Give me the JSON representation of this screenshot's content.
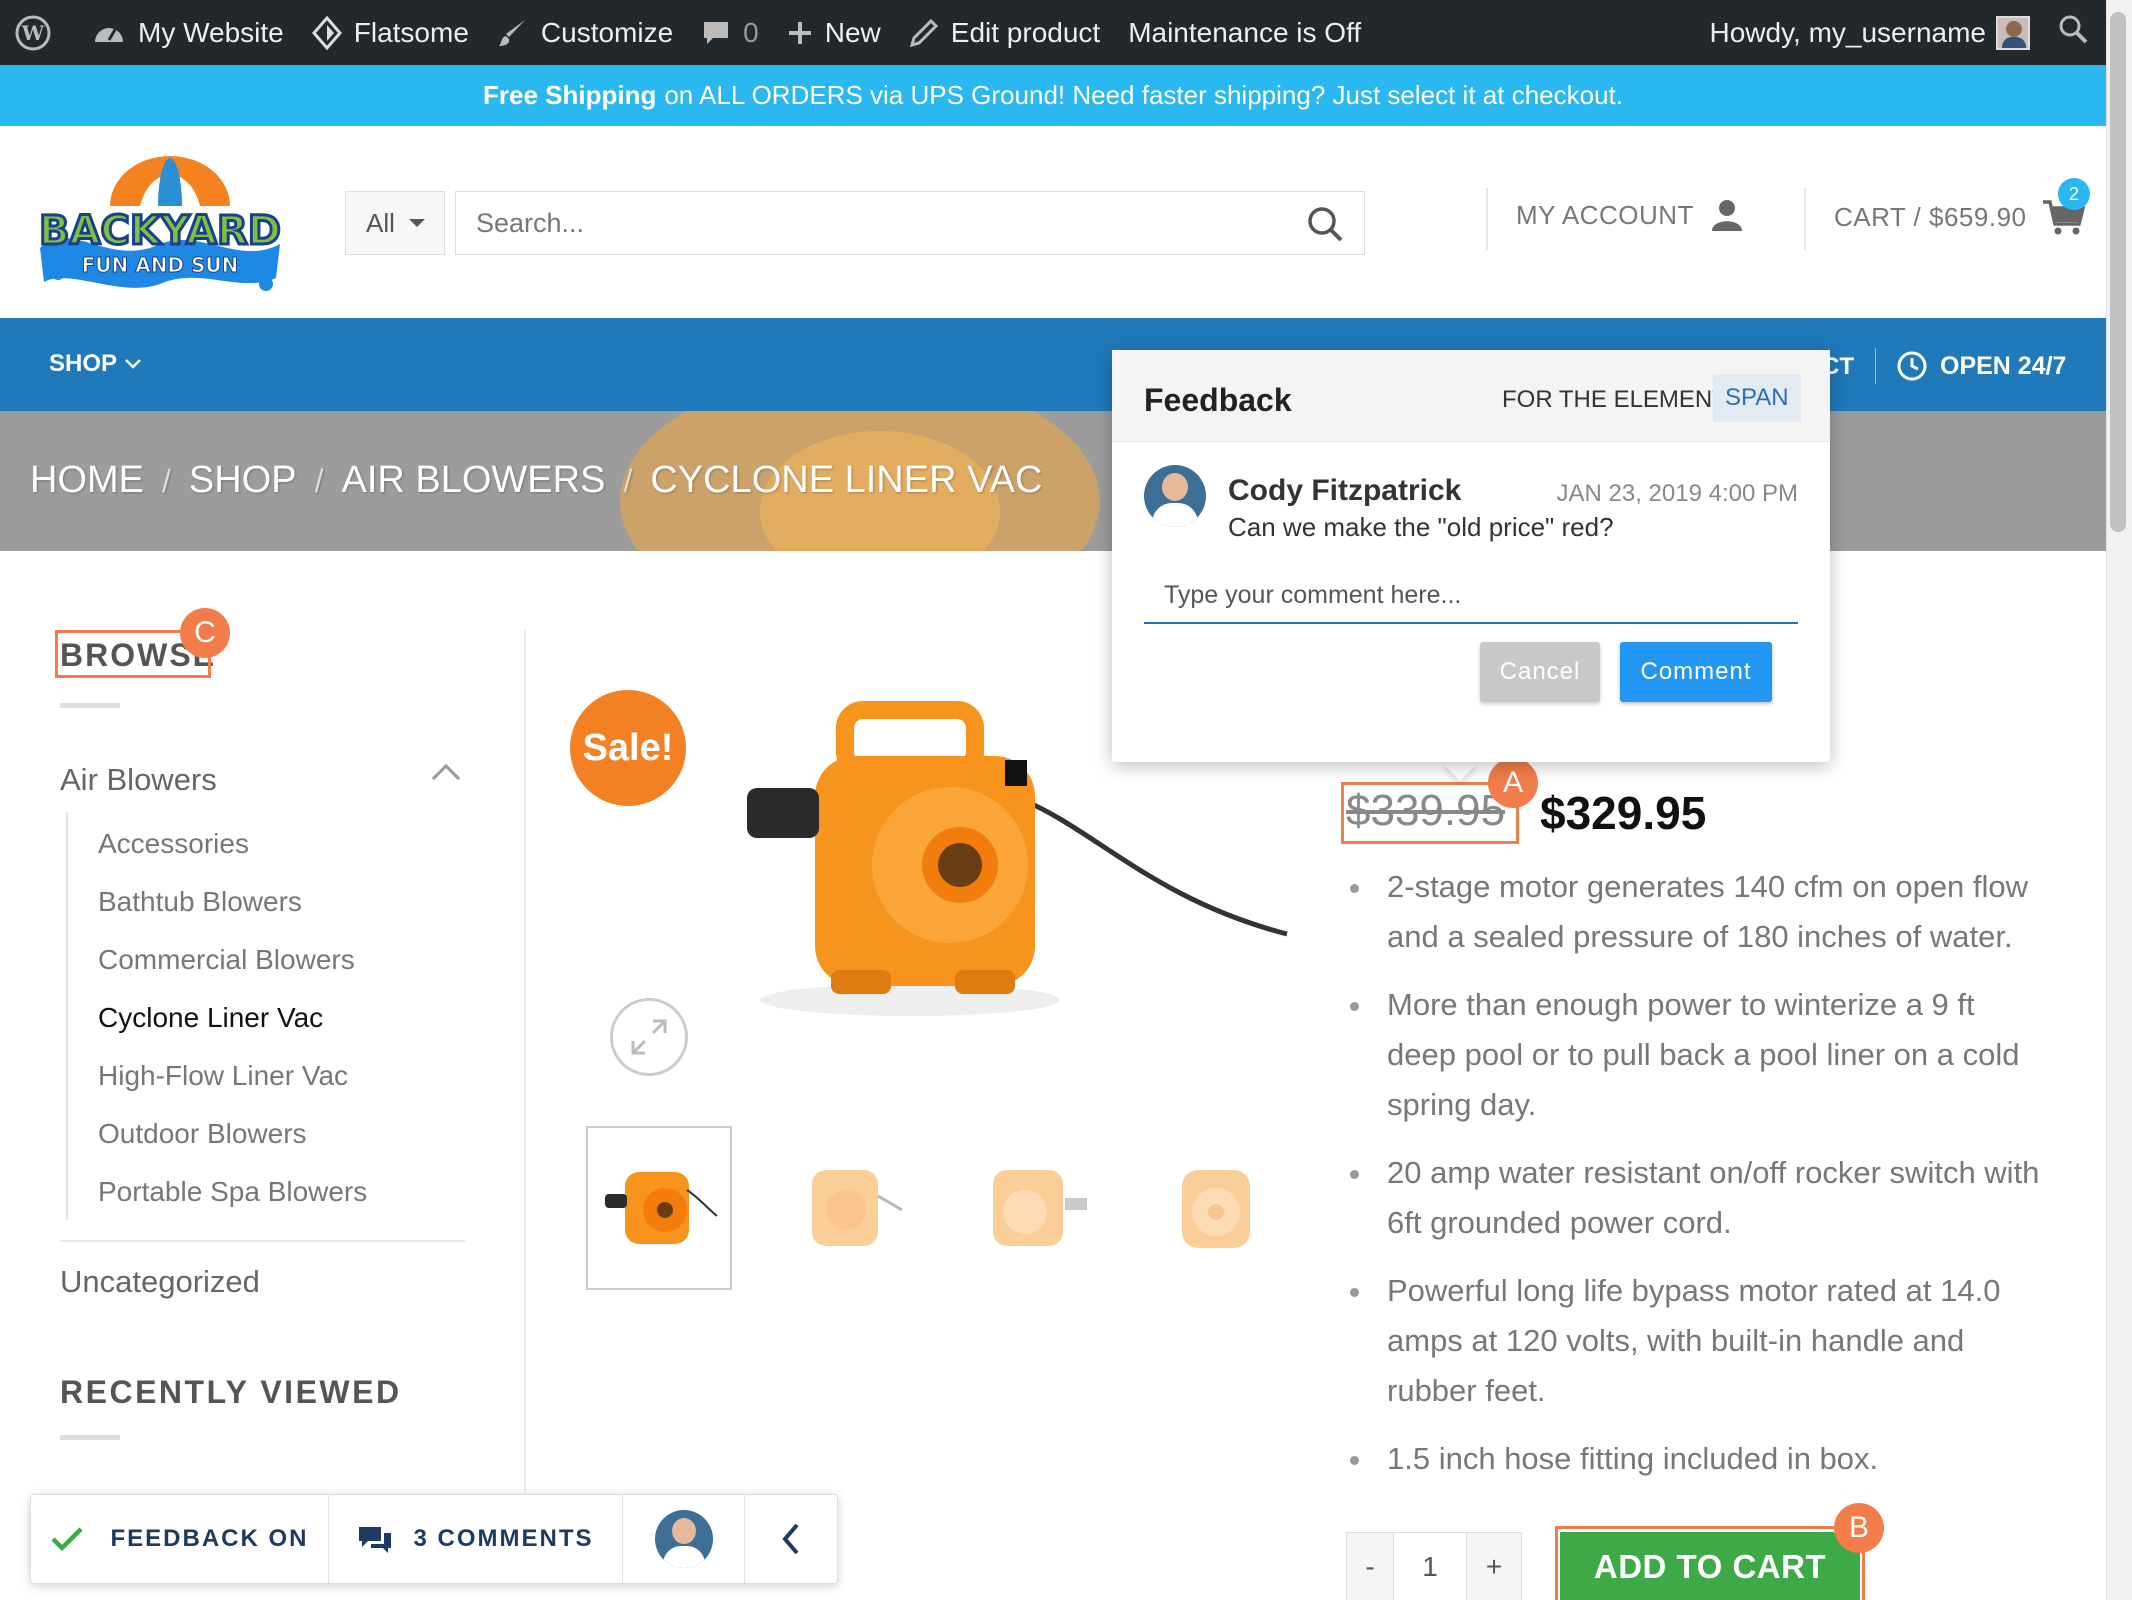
{
  "admin_bar": {
    "site_name": "My Website",
    "theme": "Flatsome",
    "customize": "Customize",
    "comments_count": "0",
    "new": "New",
    "edit_product": "Edit product",
    "maintenance": "Maintenance is Off",
    "howdy": "Howdy, my_username"
  },
  "banner": {
    "bold": "Free Shipping",
    "text": "on ALL ORDERS via UPS Ground! Need faster shipping? Just select it at checkout."
  },
  "header": {
    "logo_line1": "BACKYARD",
    "logo_line2": "FUN AND SUN",
    "search_category": "All",
    "search_placeholder": "Search...",
    "my_account": "MY ACCOUNT",
    "cart": "CART / $659.90",
    "cart_count": "2"
  },
  "nav": {
    "shop": "SHOP",
    "partial_item": "CT",
    "open": "OPEN 24/7"
  },
  "breadcrumb": [
    "HOME",
    "SHOP",
    "AIR BLOWERS",
    "CYCLONE LINER VAC"
  ],
  "sidebar": {
    "browse_title": "BROWSE",
    "main_category": "Air Blowers",
    "subcategories": [
      "Accessories",
      "Bathtub Blowers",
      "Commercial Blowers",
      "Cyclone Liner Vac",
      "High-Flow Liner Vac",
      "Outdoor Blowers",
      "Portable Spa Blowers"
    ],
    "active_index": 3,
    "uncategorized": "Uncategorized",
    "recently_viewed": "RECENTLY VIEWED"
  },
  "markers": {
    "a": "A",
    "b": "B",
    "c": "C"
  },
  "product": {
    "sale_badge": "Sale!",
    "old_price": "$339.95",
    "new_price": "$329.95",
    "features": [
      "2-stage motor generates 140 cfm on open flow and a sealed pressure of 180 inches of water.",
      "More than enough power to winterize a 9 ft deep pool or to pull back a pool liner on a cold spring day.",
      "20 amp water resistant on/off rocker switch with 6ft grounded power cord.",
      "Powerful long life bypass motor rated at 14.0 amps at 120 volts, with built-in handle and rubber feet.",
      "1.5 inch hose fitting included in box."
    ],
    "qty_minus": "-",
    "qty_value": "1",
    "qty_plus": "+",
    "add_to_cart": "ADD TO CART",
    "colors": {
      "sale": "#f48024",
      "add_to_cart": "#3eaa47",
      "accent": "#2079b8"
    }
  },
  "feedback_popup": {
    "title": "Feedback",
    "for_element": "FOR THE ELEMENT",
    "element_tag": "SPAN",
    "author": "Cody Fitzpatrick",
    "date": "JAN 23, 2019 4:00 PM",
    "comment": "Can we make the \"old price\" red?",
    "input_placeholder": "Type your comment here...",
    "cancel": "Cancel",
    "submit": "Comment"
  },
  "feedback_bar": {
    "feedback_on": "FEEDBACK ON",
    "comments": "3 COMMENTS"
  }
}
